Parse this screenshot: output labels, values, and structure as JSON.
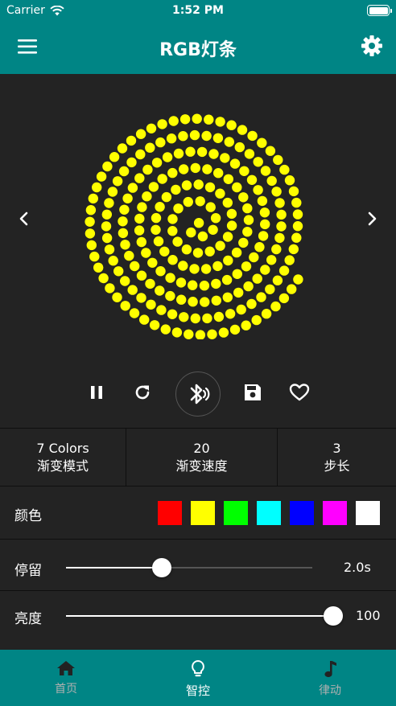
{
  "status_bar": {
    "carrier": "Carrier",
    "time": "1:52 PM"
  },
  "navbar": {
    "title": "RGB灯条"
  },
  "led": {
    "color": "#ffff00"
  },
  "controls": [
    "pause-icon",
    "refresh-icon",
    "bluetooth-icon",
    "save-icon",
    "heart-icon"
  ],
  "params": [
    {
      "value": "7 Colors",
      "label": "渐变模式"
    },
    {
      "value": "20",
      "label": "渐变速度"
    },
    {
      "value": "3",
      "label": "步长"
    }
  ],
  "colors": {
    "label": "颜色",
    "swatches": [
      "#ff0000",
      "#ffff00",
      "#00ff00",
      "#00ffff",
      "#0000ff",
      "#ff00ff",
      "#ffffff"
    ]
  },
  "stay": {
    "label": "停留",
    "value_text": "2.0s",
    "level": 0.39
  },
  "brightness": {
    "label": "亮度",
    "value_text": "100",
    "level": 1.0
  },
  "tabs": [
    {
      "label": "首页",
      "icon": "home-icon",
      "active": false
    },
    {
      "label": "智控",
      "icon": "lightbulb-icon",
      "active": true
    },
    {
      "label": "律动",
      "icon": "music-note-icon",
      "active": false
    }
  ],
  "theme": {
    "primary": "#008585",
    "background": "#232323"
  }
}
